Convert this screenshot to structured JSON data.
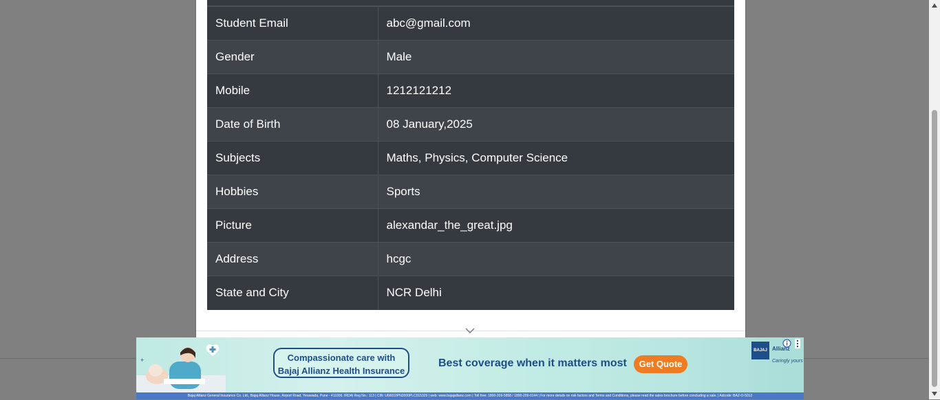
{
  "details": [
    {
      "label": "Student Email",
      "value": "abc@gmail.com"
    },
    {
      "label": "Gender",
      "value": "Male"
    },
    {
      "label": "Mobile",
      "value": "1212121212"
    },
    {
      "label": "Date of Birth",
      "value": "08 January,2025"
    },
    {
      "label": "Subjects",
      "value": "Maths, Physics, Computer Science"
    },
    {
      "label": "Hobbies",
      "value": "Sports"
    },
    {
      "label": "Picture",
      "value": "alexandar_the_great.jpg"
    },
    {
      "label": "Address",
      "value": "hcgc"
    },
    {
      "label": "State and City",
      "value": "NCR Delhi"
    }
  ],
  "ad": {
    "bubble_line1": "Compassionate care with",
    "bubble_line2": "Bajaj Allianz Health Insurance",
    "tagline": "Best coverage when it matters most",
    "cta": "Get Quote",
    "logo_text": "BAJAJ",
    "brand": "Allianz",
    "slogan": "Caringly yours",
    "disclaimer": "Bajaj Allianz General Insurance Co. Ltd., Bajaj Allianz House, Airport Road, Yerawada, Pune - 411006. IRDAI Reg No.: 113 | CIN: U66010PN2000PLC015329 | web: www.bajajallianz.com | Toll free: 1800-209-5858 / 1800-209-0144 | For more details on risk factors and Terms and Conditions, please read the sales brochure before concluding a sale. | Adcode: BAZ-O-5012"
  },
  "colors": {
    "table_dark": "#343a40",
    "table_stripe": "#3e444a",
    "overlay": "#808080",
    "cta": "#ef7b22",
    "brand_blue": "#1d4e88"
  }
}
